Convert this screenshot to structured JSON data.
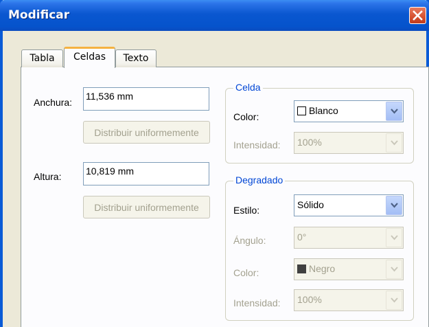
{
  "window": {
    "title": "Modificar"
  },
  "tabs": [
    {
      "label": "Tabla"
    },
    {
      "label": "Celdas"
    },
    {
      "label": "Texto"
    }
  ],
  "sizes": {
    "width_label": "Anchura:",
    "width_value": "11,536 mm",
    "width_distribute": "Distribuir uniformemente",
    "height_label": "Altura:",
    "height_value": "10,819 mm",
    "height_distribute": "Distribuir uniformemente"
  },
  "cell_group": {
    "title": "Celda",
    "color_label": "Color:",
    "color_value": "Blanco",
    "color_swatch": "#ffffff",
    "intensity_label": "Intensidad:",
    "intensity_value": "100%"
  },
  "gradient_group": {
    "title": "Degradado",
    "style_label": "Estilo:",
    "style_value": "Sólido",
    "angle_label": "Ángulo:",
    "angle_value": "0°",
    "color_label": "Color:",
    "color_value": "Negro",
    "color_swatch": "#404040",
    "intensity_label": "Intensidad:",
    "intensity_value": "100%"
  }
}
